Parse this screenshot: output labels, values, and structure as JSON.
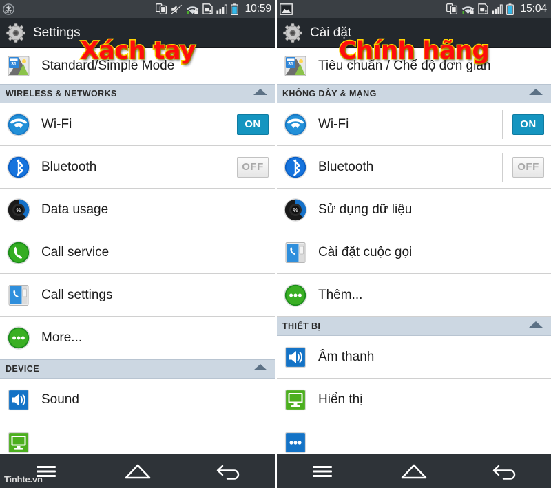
{
  "left": {
    "caption": "Xách tay",
    "statusbar": {
      "clock": "10:59",
      "left_icons": [
        "gps-off-icon"
      ],
      "right_icons": [
        "screen-mirroring-icon",
        "mute-icon",
        "wifi-secure-icon",
        "sim-alert-icon",
        "signal-bars-icon",
        "battery-icon"
      ]
    },
    "actionbar": {
      "title": "Settings",
      "icon": "settings-gear-icon"
    },
    "items": [
      {
        "kind": "row",
        "name": "mode-switch",
        "icon": "simple-mode-icon",
        "label": "Standard/Simple Mode",
        "mode": true
      },
      {
        "kind": "section",
        "name": "wireless-networks",
        "label": "WIRELESS & NETWORKS"
      },
      {
        "kind": "row",
        "name": "wifi",
        "icon": "wifi-icon",
        "label": "Wi-Fi",
        "toggle": "ON"
      },
      {
        "kind": "row",
        "name": "bluetooth",
        "icon": "bluetooth-icon",
        "label": "Bluetooth",
        "toggle": "OFF"
      },
      {
        "kind": "row",
        "name": "data-usage",
        "icon": "data-usage-icon",
        "label": "Data usage"
      },
      {
        "kind": "row",
        "name": "call-service",
        "icon": "call-service-icon",
        "label": "Call service"
      },
      {
        "kind": "row",
        "name": "call-settings",
        "icon": "call-settings-icon",
        "label": "Call settings"
      },
      {
        "kind": "row",
        "name": "more",
        "icon": "more-icon",
        "label": "More..."
      },
      {
        "kind": "section",
        "name": "device",
        "label": "DEVICE"
      },
      {
        "kind": "row",
        "name": "sound",
        "icon": "sound-icon",
        "label": "Sound"
      },
      {
        "kind": "row",
        "name": "display",
        "icon": "display-icon",
        "label": ""
      }
    ],
    "navbar": {
      "menu": "menu-icon",
      "home": "home-icon",
      "back": "back-icon"
    },
    "watermark": "Tinhte.vn"
  },
  "right": {
    "caption": "Chính hãng",
    "statusbar": {
      "clock": "15:04",
      "left_icons": [
        "screenshot-image-icon"
      ],
      "right_icons": [
        "screen-mirroring-icon",
        "wifi-secure-icon",
        "sim-alert-icon",
        "signal-bars-icon",
        "battery-icon"
      ]
    },
    "actionbar": {
      "title": "Cài đặt",
      "icon": "settings-gear-icon"
    },
    "items": [
      {
        "kind": "row",
        "name": "mode-switch",
        "icon": "simple-mode-icon",
        "label": "Tiêu chuẩn / Chế độ đơn giản",
        "mode": true
      },
      {
        "kind": "section",
        "name": "wireless-networks",
        "label": "KHÔNG DÂY & MẠNG"
      },
      {
        "kind": "row",
        "name": "wifi",
        "icon": "wifi-icon",
        "label": "Wi-Fi",
        "toggle": "ON"
      },
      {
        "kind": "row",
        "name": "bluetooth",
        "icon": "bluetooth-icon",
        "label": "Bluetooth",
        "toggle": "OFF"
      },
      {
        "kind": "row",
        "name": "data-usage",
        "icon": "data-usage-icon",
        "label": "Sử dụng dữ liệu"
      },
      {
        "kind": "row",
        "name": "call-settings",
        "icon": "call-settings-icon",
        "label": "Cài đặt cuộc gọi"
      },
      {
        "kind": "row",
        "name": "more",
        "icon": "more-icon",
        "label": "Thêm..."
      },
      {
        "kind": "section",
        "name": "device",
        "label": "THIẾT BỊ"
      },
      {
        "kind": "row",
        "name": "sound",
        "icon": "sound-icon",
        "label": "Âm thanh"
      },
      {
        "kind": "row",
        "name": "display",
        "icon": "display-icon",
        "label": "Hiển thị"
      },
      {
        "kind": "row",
        "name": "more-device",
        "icon": "more-blue-icon",
        "label": ""
      }
    ],
    "navbar": {
      "menu": "menu-icon",
      "home": "home-icon",
      "back": "back-icon"
    }
  },
  "colors": {
    "toggle_on": "#1595c0",
    "caption_fill": "#ff0d0d",
    "caption_stroke": "#ffd400",
    "section_bg": "#ccd7e2",
    "actionbar_bg": "#23282d",
    "statusbar_bg": "#3a3f44",
    "navbar_bg": "#2e3338"
  }
}
